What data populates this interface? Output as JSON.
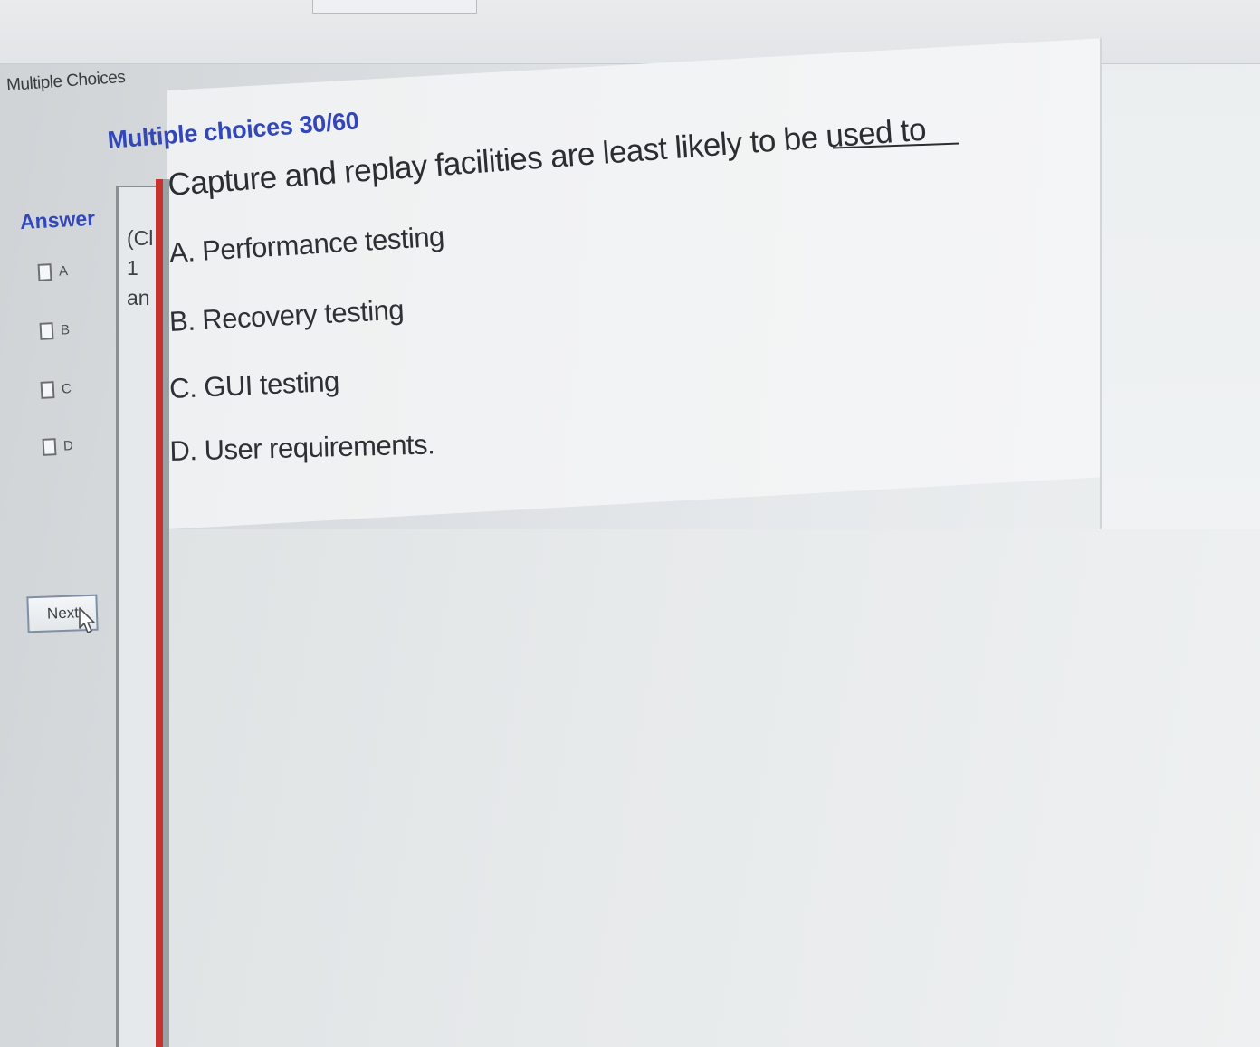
{
  "section": {
    "title": "Multiple Choices"
  },
  "quiz": {
    "counter": "Multiple choices 30/60",
    "question": "Capture and replay facilities are least likely to be used to",
    "choices": [
      {
        "label": "A. Performance testing"
      },
      {
        "label": "B. Recovery testing"
      },
      {
        "label": "C. GUI testing"
      },
      {
        "label": "D. User requirements."
      }
    ]
  },
  "answer_panel": {
    "heading": "Answer",
    "options": [
      {
        "letter": "A",
        "checked": false
      },
      {
        "letter": "B",
        "checked": false
      },
      {
        "letter": "C",
        "checked": false
      },
      {
        "letter": "D",
        "checked": false
      }
    ],
    "next_label": "Next"
  },
  "side_column": {
    "lines": [
      "(Cl",
      "1",
      "an"
    ]
  },
  "colors": {
    "accent_blue": "#3347b8",
    "divider_red": "#c4332d"
  },
  "icons": {
    "cursor": "mouse-pointer-icon"
  }
}
